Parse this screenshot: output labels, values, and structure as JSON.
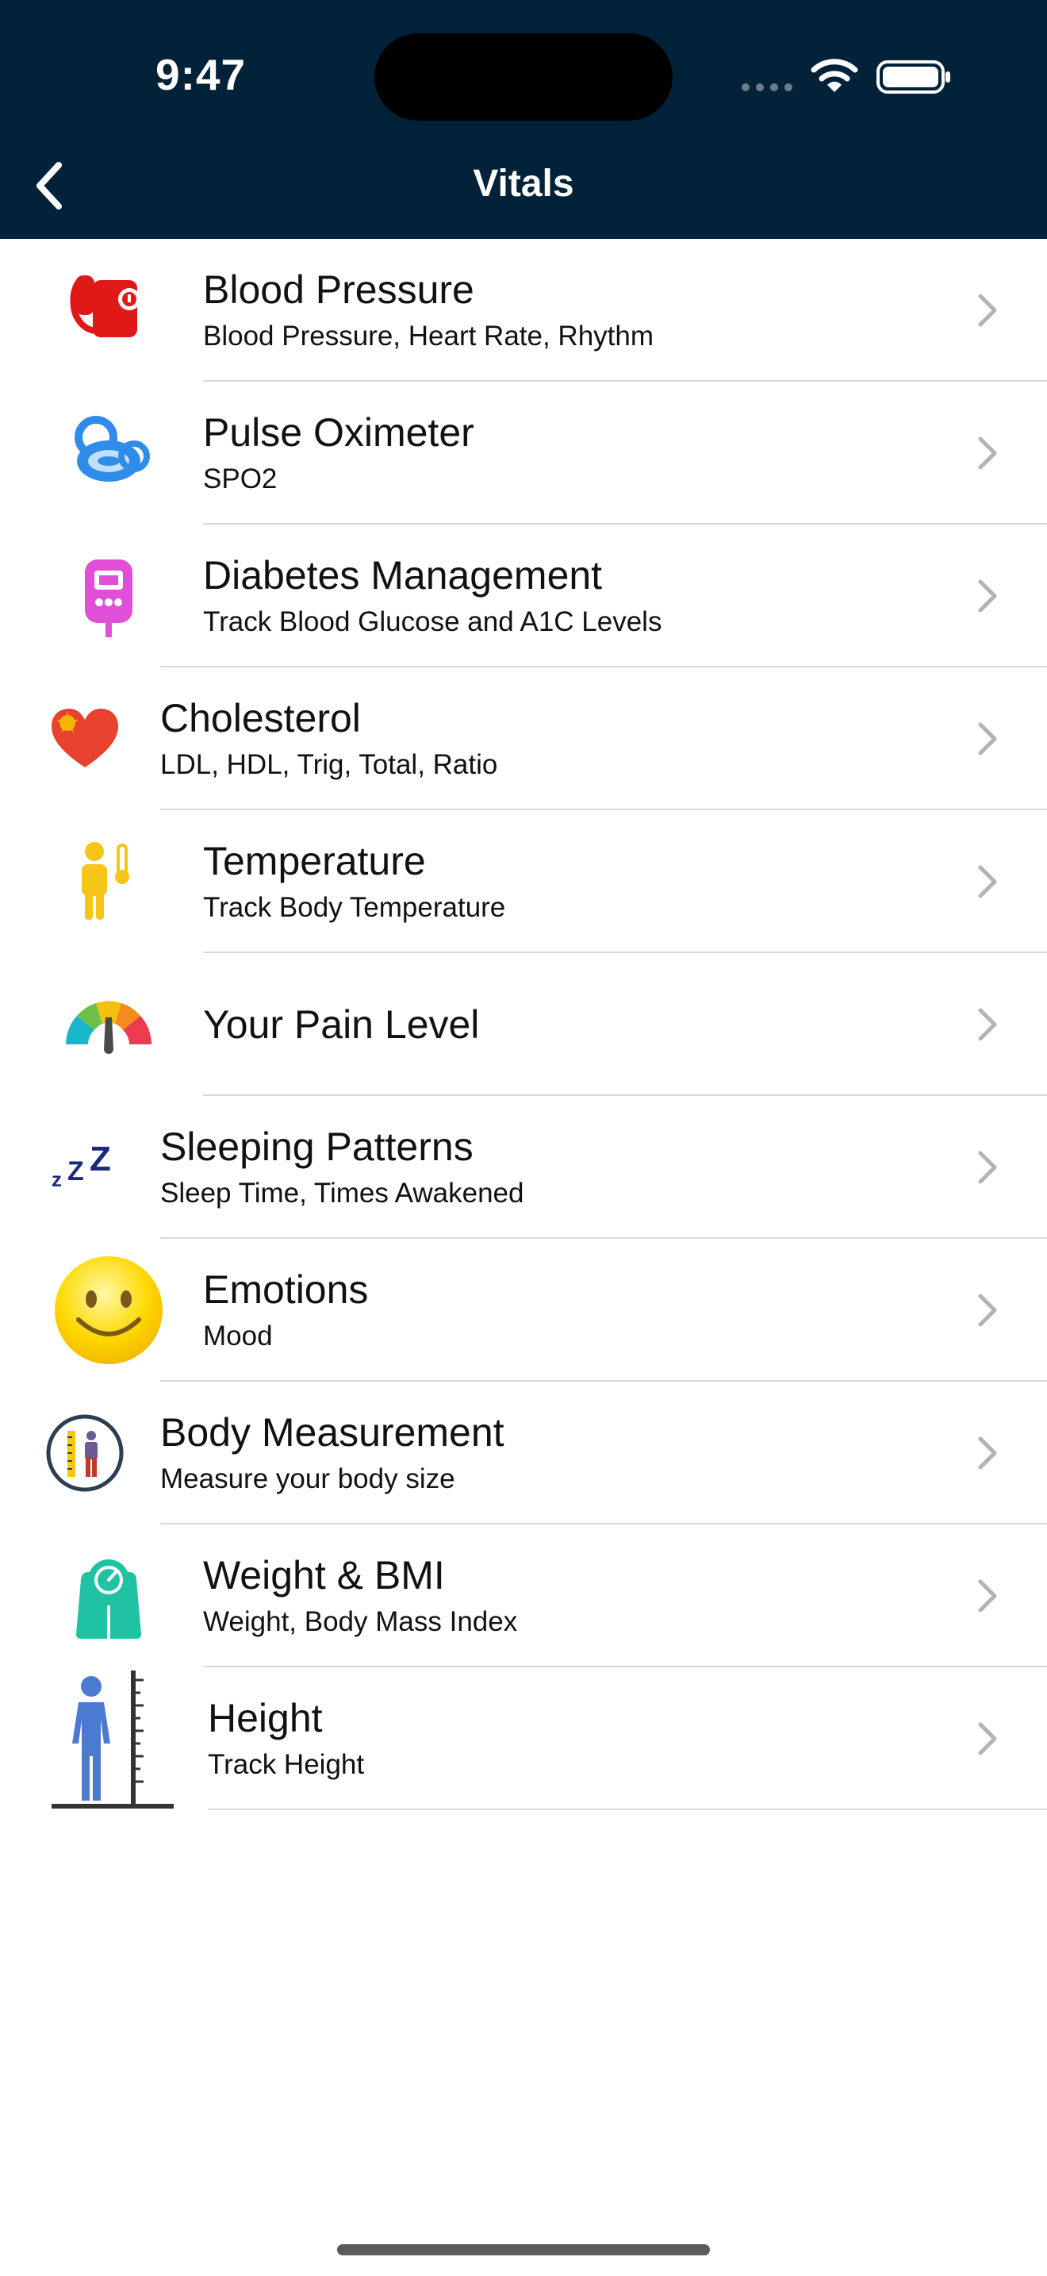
{
  "status_bar": {
    "time": "9:47"
  },
  "nav": {
    "title": "Vitals"
  },
  "items": [
    {
      "title": "Blood Pressure",
      "subtitle": "Blood Pressure, Heart Rate, Rhythm",
      "icon": "blood-pressure-cuff-icon"
    },
    {
      "title": "Pulse Oximeter",
      "subtitle": "SPO2",
      "icon": "pulse-oximeter-icon"
    },
    {
      "title": "Diabetes Management",
      "subtitle": "Track Blood Glucose and A1C Levels",
      "icon": "glucose-meter-icon"
    },
    {
      "title": "Cholesterol",
      "subtitle": "LDL, HDL, Trig, Total, Ratio",
      "icon": "heart-icon"
    },
    {
      "title": "Temperature",
      "subtitle": "Track Body Temperature",
      "icon": "thermometer-person-icon"
    },
    {
      "title": "Your Pain Level",
      "subtitle": "",
      "icon": "pain-gauge-icon"
    },
    {
      "title": "Sleeping Patterns",
      "subtitle": "Sleep Time, Times Awakened",
      "icon": "zzz-icon"
    },
    {
      "title": "Emotions",
      "subtitle": "Mood",
      "icon": "smiley-icon"
    },
    {
      "title": "Body Measurement",
      "subtitle": "Measure your body size",
      "icon": "body-measure-icon"
    },
    {
      "title": "Weight & BMI",
      "subtitle": "Weight, Body Mass Index",
      "icon": "scale-icon"
    },
    {
      "title": "Height",
      "subtitle": "Track Height",
      "icon": "height-ruler-icon"
    }
  ]
}
